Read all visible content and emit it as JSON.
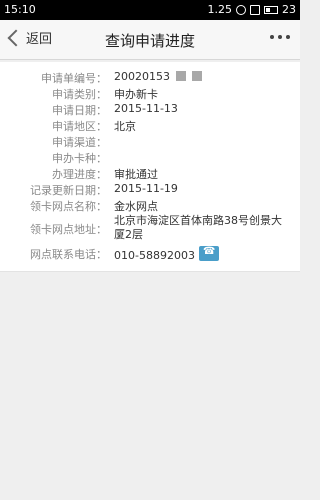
{
  "status_bar": {
    "time": "15:10",
    "battery": "1.25",
    "percent": "23"
  },
  "header": {
    "back_label": "返回",
    "title": "查询申请进度"
  },
  "details": [
    {
      "label": "申请单编号：",
      "value": "20020153"
    },
    {
      "label": "申请类别：",
      "value": "申办新卡"
    },
    {
      "label": "申请日期：",
      "value": "2015-11-13"
    },
    {
      "label": "申请地区：",
      "value": "北京"
    },
    {
      "label": "申请渠道：",
      "value": ""
    },
    {
      "label": "申办卡种：",
      "value": ""
    },
    {
      "label": "办理进度：",
      "value": "审批通过"
    },
    {
      "label": "记录更新日期：",
      "value": "2015-11-19"
    },
    {
      "label": "领卡网点名称：",
      "value": "金水网点"
    },
    {
      "label": "领卡网点地址：",
      "value": "北京市海淀区首体南路38号创景大厦2层"
    },
    {
      "label": "网点联系电话：",
      "value": "010-58892003"
    }
  ]
}
